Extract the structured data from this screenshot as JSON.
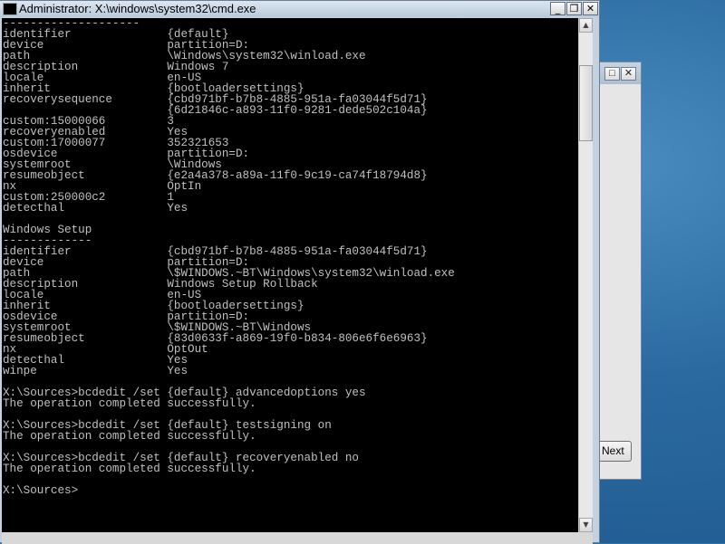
{
  "window": {
    "title": "Administrator: X:\\windows\\system32\\cmd.exe",
    "minimize": "_",
    "maximize": "❐",
    "close": "✕"
  },
  "background_window": {
    "maximize": "□",
    "close": "✕",
    "next_button": "Next"
  },
  "scrollbar": {
    "up": "▲",
    "down": "▼"
  },
  "console": {
    "lines": [
      "--------------------",
      "identifier              {default}",
      "device                  partition=D:",
      "path                    \\Windows\\system32\\winload.exe",
      "description             Windows 7",
      "locale                  en-US",
      "inherit                 {bootloadersettings}",
      "recoverysequence        {cbd971bf-b7b8-4885-951a-fa03044f5d71}",
      "                        {6d21846c-a893-11f0-9281-dede502c104a}",
      "custom:15000066         3",
      "recoveryenabled         Yes",
      "custom:17000077         352321653",
      "osdevice                partition=D:",
      "systemroot              \\Windows",
      "resumeobject            {e2a4a378-a89a-11f0-9c19-ca74f18794d8}",
      "nx                      OptIn",
      "custom:250000c2         1",
      "detecthal               Yes",
      "",
      "Windows Setup",
      "-------------",
      "identifier              {cbd971bf-b7b8-4885-951a-fa03044f5d71}",
      "device                  partition=D:",
      "path                    \\$WINDOWS.~BT\\Windows\\system32\\winload.exe",
      "description             Windows Setup Rollback",
      "locale                  en-US",
      "inherit                 {bootloadersettings}",
      "osdevice                partition=D:",
      "systemroot              \\$WINDOWS.~BT\\Windows",
      "resumeobject            {83d0633f-a869-19f0-b834-806e6f6e6963}",
      "nx                      OptOut",
      "detecthal               Yes",
      "winpe                   Yes",
      "",
      "X:\\Sources>bcdedit /set {default} advancedoptions yes",
      "The operation completed successfully.",
      "",
      "X:\\Sources>bcdedit /set {default} testsigning on",
      "The operation completed successfully.",
      "",
      "X:\\Sources>bcdedit /set {default} recoveryenabled no",
      "The operation completed successfully.",
      "",
      "X:\\Sources>"
    ]
  }
}
